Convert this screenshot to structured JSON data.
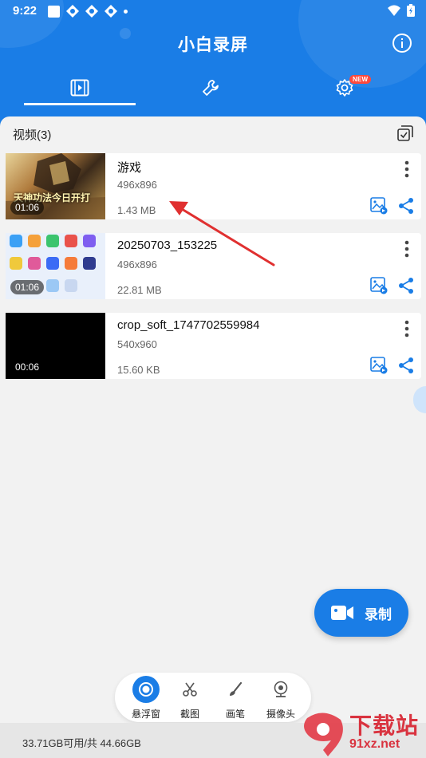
{
  "status_bar": {
    "time": "9:22"
  },
  "header": {
    "title": "小白录屏",
    "badge": "NEW"
  },
  "section": {
    "title": "视频(3)"
  },
  "videos": [
    {
      "name": "游戏",
      "resolution": "496x896",
      "size": "1.43 MB",
      "duration": "01:06",
      "thumb_text": "天神功法今日开打"
    },
    {
      "name": "20250703_153225",
      "resolution": "496x896",
      "size": "22.81 MB",
      "duration": "01:06"
    },
    {
      "name": "crop_soft_1747702559984",
      "resolution": "540x960",
      "size": "15.60 KB",
      "duration": "00:06"
    }
  ],
  "fab": {
    "label": "录制"
  },
  "toolbar": [
    {
      "label": "悬浮窗",
      "icon": "float-icon"
    },
    {
      "label": "截图",
      "icon": "scissors-icon"
    },
    {
      "label": "画笔",
      "icon": "brush-icon"
    },
    {
      "label": "摄像头",
      "icon": "camera-icon"
    }
  ],
  "footer": {
    "storage": "33.71GB可用/共 44.66GB"
  },
  "watermark": {
    "text": "下载站",
    "url": "91xz.net"
  },
  "colors": {
    "primary": "#1a7de6",
    "arrow": "#e03030",
    "badge": "#ff4a3d"
  }
}
